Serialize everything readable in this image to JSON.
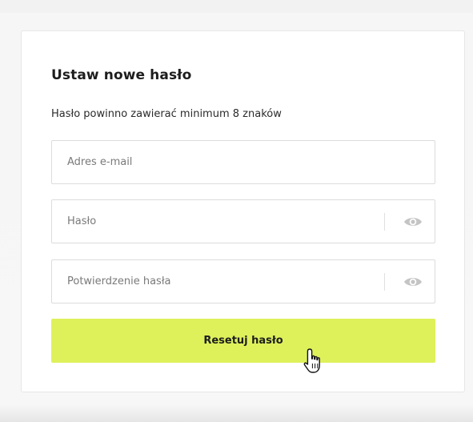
{
  "form": {
    "title": "Ustaw nowe hasło",
    "hint": "Hasło powinno zawierać minimum 8 znaków",
    "fields": [
      {
        "name": "email",
        "placeholder": "Adres e-mail",
        "value": ""
      },
      {
        "name": "password",
        "placeholder": "Hasło",
        "value": "",
        "toggle_icon": "eye-icon"
      },
      {
        "name": "password_confirm",
        "placeholder": "Potwierdzenie hasła",
        "value": "",
        "toggle_icon": "eye-icon"
      }
    ],
    "submit_label": "Resetuj hasło"
  },
  "colors": {
    "accent": "#def15b",
    "card_bg": "#ffffff",
    "border": "#dcdcdc",
    "text": "#1d1d1d",
    "placeholder": "#7a7a7a",
    "icon": "#c4c4c4"
  }
}
